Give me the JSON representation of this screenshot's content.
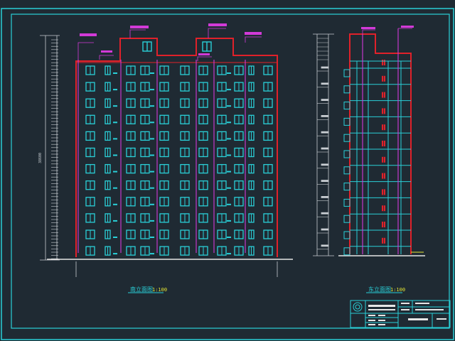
{
  "colors": {
    "background": "#1f2a33",
    "frame": "#2ad0d8",
    "outline": "#e0212a",
    "window": "#2ad0d8",
    "pipe": "#d23ad8",
    "dim_line": "#c8cdd2",
    "ground": "#e6e6e6",
    "title_text": "#2ad0d8",
    "scale_text": "#e6e633"
  },
  "front_elevation": {
    "title": "南立面图",
    "scale": "1:100",
    "floors": 12,
    "window_columns": 11
  },
  "side_elevation": {
    "title": "东立面图",
    "scale": "1:100",
    "floors": 12
  }
}
